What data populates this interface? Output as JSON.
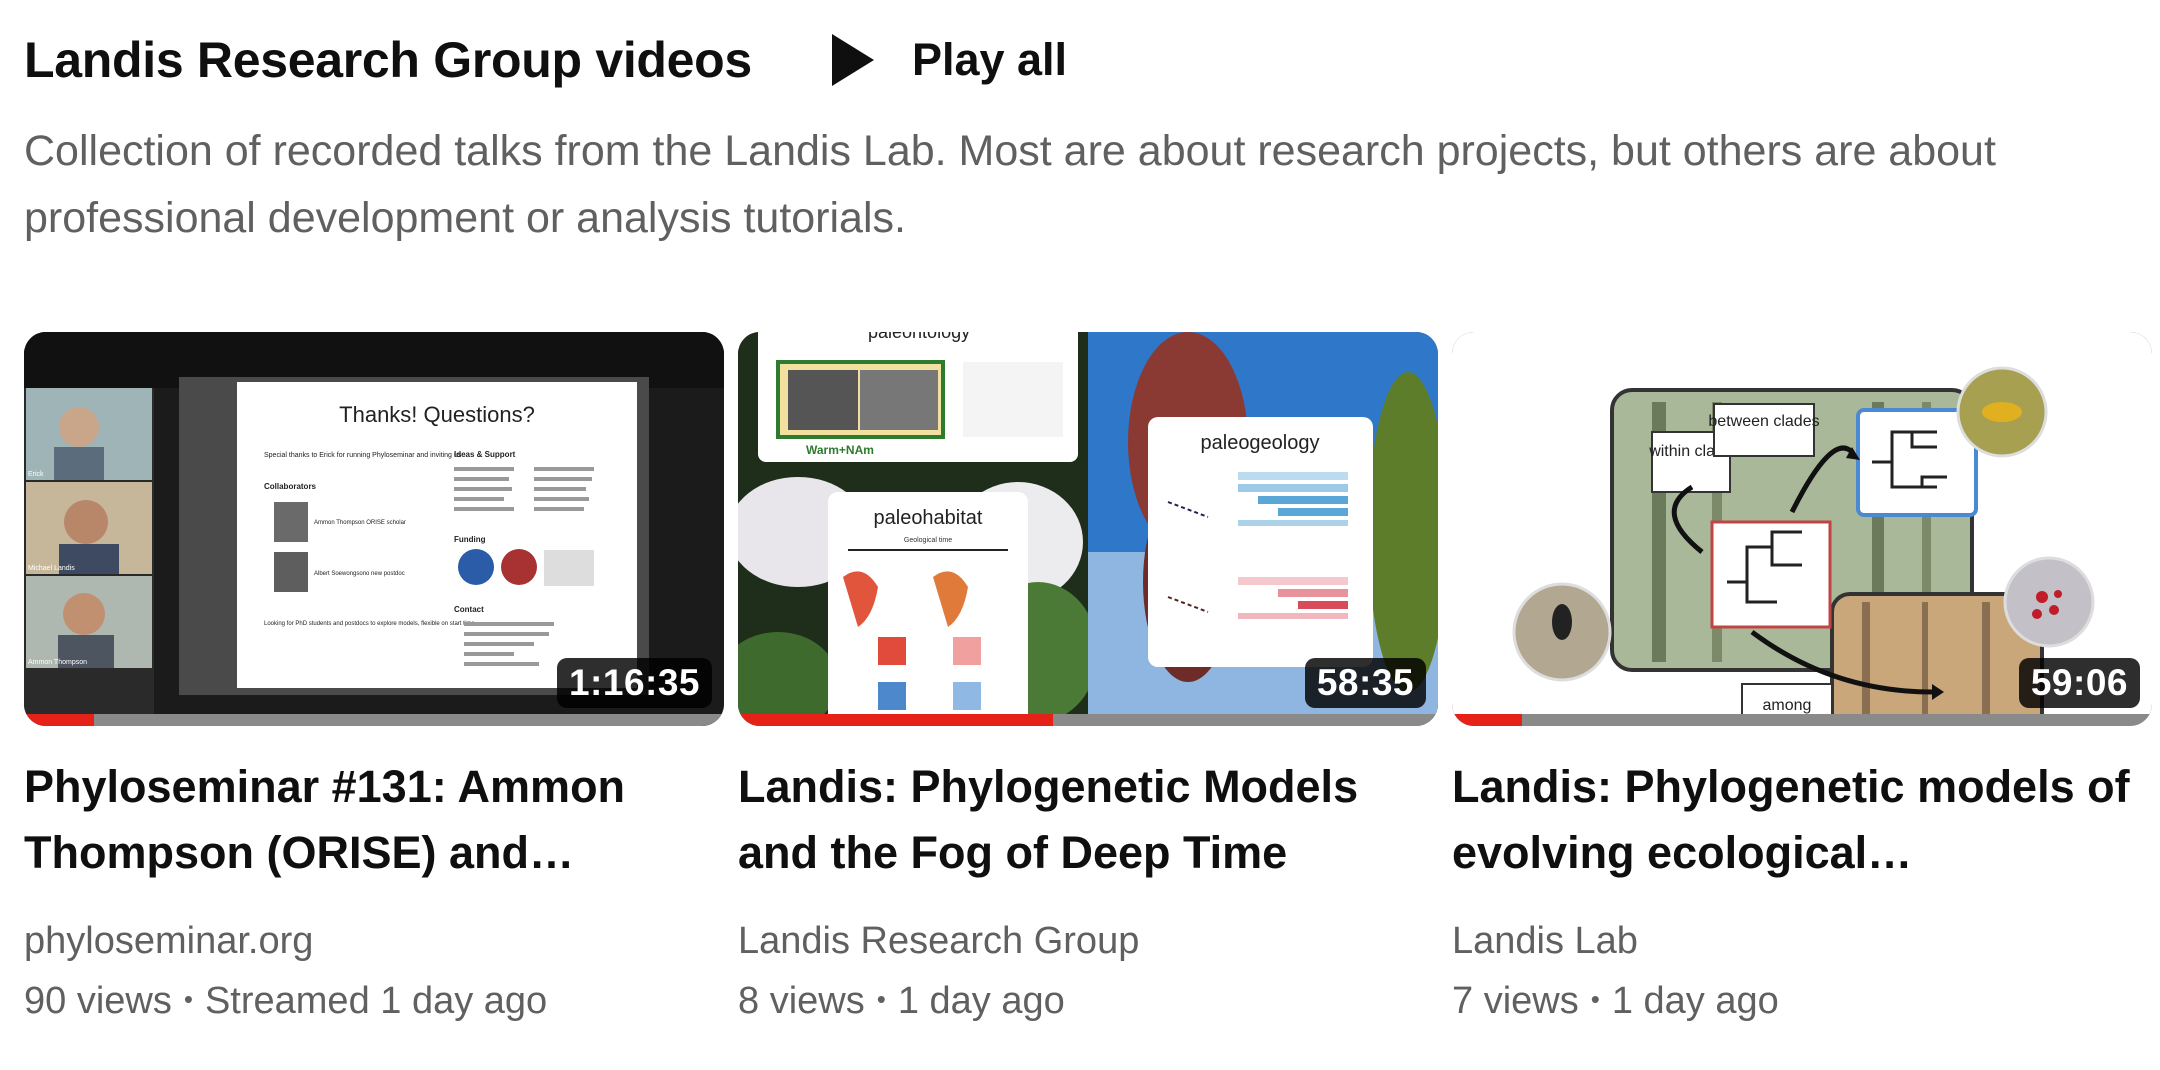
{
  "playlist": {
    "title": "Landis Research Group videos",
    "play_all_label": "Play all",
    "description": "Collection of recorded talks from the Landis Lab. Most are about research projects, but others are about professional development or analysis tutorials."
  },
  "videos": [
    {
      "title": "Phyloseminar #131: Ammon Thompson (ORISE) and…",
      "channel": "phyloseminar.org",
      "views": "90 views",
      "age": "Streamed 1 day ago",
      "duration": "1:16:35",
      "watch_progress": 0.1,
      "thumbnail_text": {
        "heading": "Thanks! Questions?",
        "special_thanks": "Special thanks to Erick for running Phyloseminar and inviting us",
        "collaborators_heading": "Collaborators",
        "collaborator_1": "Ammon Thompson ORISE scholar",
        "collaborator_2": "Albert Soewongsono new postdoc",
        "ideas_heading": "Ideas & Support",
        "funding_heading": "Funding",
        "contact_heading": "Contact",
        "looking_for": "Looking for PhD students and postdocs to explore models, flexible on start time",
        "participant_1": "Erick",
        "participant_2": "Michael Landis",
        "participant_3": "Ammon Thompson"
      }
    },
    {
      "title": "Landis: Phylogenetic Models and the Fog of Deep Time",
      "channel": "Landis Research Group",
      "views": "8 views",
      "age": "1 day ago",
      "duration": "58:35",
      "watch_progress": 0.45,
      "thumbnail_text": {
        "top_label": "paleontology",
        "warm_label": "Warm+NAm",
        "habitat_label": "paleohabitat",
        "habitat_axis": "Geological time",
        "geology_label": "paleogeology"
      }
    },
    {
      "title": "Landis: Phylogenetic models of evolving ecological…",
      "channel": "Landis Lab",
      "views": "7 views",
      "age": "1 day ago",
      "duration": "59:06",
      "watch_progress": 0.1,
      "thumbnail_text": {
        "within": "within clade",
        "between": "between clades",
        "among": "among"
      }
    }
  ],
  "colors": {
    "progress_red": "#e62117",
    "meta_gray": "#606060"
  }
}
